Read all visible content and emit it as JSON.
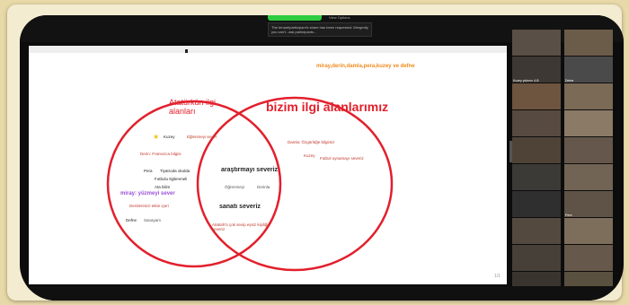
{
  "notification": {
    "text": "The tenant/participant's share has been requested. Mergedly you can't...ask participants..."
  },
  "toolbar": {
    "view_options": "View Options"
  },
  "slide": {
    "names": "miray,derin,damla,pera,kuzey ve defne",
    "left_title_1": "Atatürkün ilgi",
    "left_title_2": "alanları",
    "right_title": "bizim ilgi alanlarımız",
    "page_num": "1/1"
  },
  "left_items": {
    "kuzey": "Kuzey",
    "eglenmeyi": "Eğlenmeyi sever",
    "derin": "Derin: Fransızca bilgisi",
    "pera": "Pera",
    "tiyatroda": "Tiyatroda okulda",
    "futbolu": "Futbolu Ilgilenmeli",
    "okumayi": "Ata bilim",
    "miray": "miray: yüzmeyi sever",
    "derslerini": "Derslerimizi etkin içeri",
    "defne": "Defne",
    "sanayam": "Sanayam"
  },
  "middle_items": {
    "arastirmayi": "araştırmayı severiz",
    "ogrenmeyi": "Öğrenmeyi",
    "derinla": "Derinla",
    "sanati": "sanatı severiz",
    "ataturk_sevgisi": "Atatürk'ü çok sevip eşsiz kişiliği severiz"
  },
  "right_items": {
    "damla": "Damla: Özgürlüğe bilgimiz",
    "kuzey_r": "Kuzey",
    "futbol": "Futbol oynamayı severiz"
  },
  "gallery": {
    "tiles": [
      {
        "label": ""
      },
      {
        "label": ""
      },
      {
        "label": "Kuzey yıldırım 4-B"
      },
      {
        "label": "Defne"
      },
      {
        "label": ""
      },
      {
        "label": ""
      },
      {
        "label": ""
      },
      {
        "label": ""
      },
      {
        "label": ""
      },
      {
        "label": ""
      },
      {
        "label": ""
      },
      {
        "label": ""
      },
      {
        "label": ""
      },
      {
        "label": "Pera"
      },
      {
        "label": ""
      },
      {
        "label": ""
      },
      {
        "label": ""
      },
      {
        "label": ""
      },
      {
        "label": ""
      },
      {
        "label": ""
      }
    ]
  }
}
